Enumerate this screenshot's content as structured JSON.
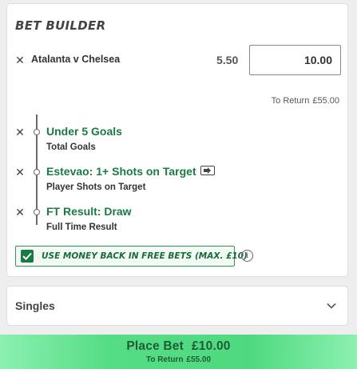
{
  "bet_builder": {
    "title": "BET BUILDER",
    "match": "Atalanta v Chelsea",
    "odds": "5.50",
    "stake": "10.00",
    "to_return_label": "To Return",
    "to_return_value": "£55.00",
    "selections": [
      {
        "title": "Under 5 Goals",
        "market": "Total Goals",
        "has_boost_icon": false
      },
      {
        "title": "Estevao: 1+ Shots on Target",
        "market": "Player Shots on Target",
        "has_boost_icon": true
      },
      {
        "title": "FT Result: Draw",
        "market": "Full Time Result",
        "has_boost_icon": false
      }
    ],
    "money_back": {
      "label": "USE MONEY BACK IN FREE BETS (MAX. £10)",
      "checked": true
    }
  },
  "singles": {
    "label": "Singles"
  },
  "place_bet": {
    "label": "Place Bet",
    "amount": "£10.00",
    "to_return_label": "To Return",
    "to_return_value": "£55.00"
  },
  "colors": {
    "accent_green": "#1a7a43",
    "button_green": "#4fd97f",
    "background": "#eeeeee"
  },
  "icons": [
    "close-icon",
    "info-icon",
    "chevron-down-icon",
    "checkbox-checked-icon",
    "bet-boost-icon"
  ]
}
